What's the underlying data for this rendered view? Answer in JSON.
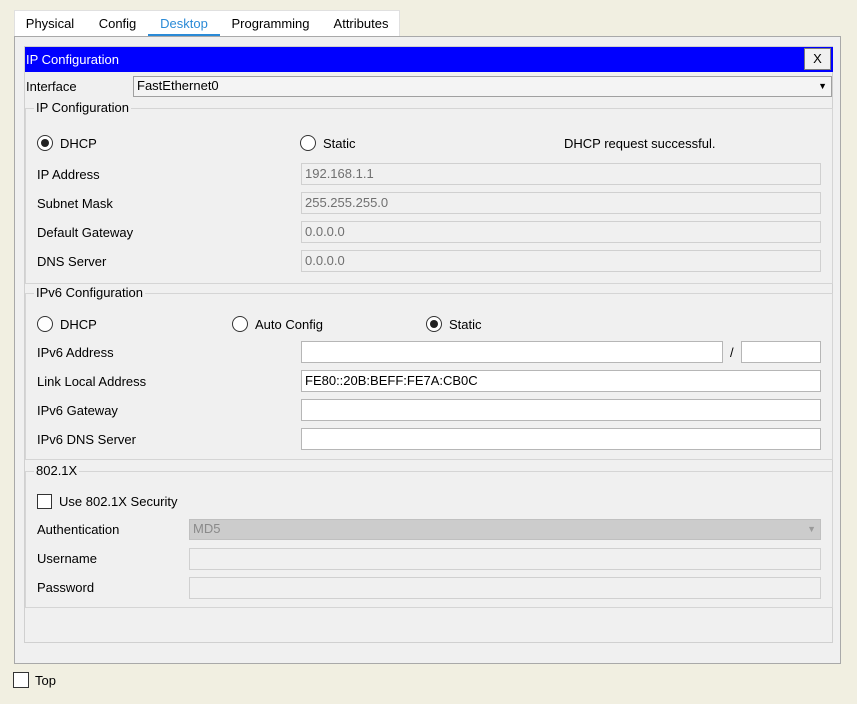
{
  "tabs": [
    "Physical",
    "Config",
    "Desktop",
    "Programming",
    "Attributes"
  ],
  "active_tab": "Desktop",
  "window": {
    "title": "IP Configuration",
    "close_label": "X"
  },
  "interface": {
    "label": "Interface",
    "value": "FastEthernet0"
  },
  "ipv4": {
    "group_title": "IP Configuration",
    "dhcp_label": "DHCP",
    "static_label": "Static",
    "mode": "DHCP",
    "status": "DHCP request successful.",
    "ip_address_label": "IP Address",
    "ip_address": "192.168.1.1",
    "subnet_mask_label": "Subnet Mask",
    "subnet_mask": "255.255.255.0",
    "default_gateway_label": "Default Gateway",
    "default_gateway": "0.0.0.0",
    "dns_server_label": "DNS Server",
    "dns_server": "0.0.0.0"
  },
  "ipv6": {
    "group_title": "IPv6 Configuration",
    "dhcp_label": "DHCP",
    "auto_config_label": "Auto Config",
    "static_label": "Static",
    "mode": "Static",
    "address_label": "IPv6 Address",
    "address": "",
    "prefix_separator": "/",
    "prefix_length": "",
    "link_local_label": "Link Local Address",
    "link_local": "FE80::20B:BEFF:FE7A:CB0C",
    "gateway_label": "IPv6 Gateway",
    "gateway": "",
    "dns_server_label": "IPv6 DNS Server",
    "dns_server": ""
  },
  "dot1x": {
    "group_title": "802.1X",
    "use_security_label": "Use 802.1X Security",
    "use_security": false,
    "authentication_label": "Authentication",
    "authentication": "MD5",
    "username_label": "Username",
    "username": "",
    "password_label": "Password",
    "password": ""
  },
  "footer": {
    "top_label": "Top",
    "top_checked": false
  },
  "colors": {
    "title_bar": "#0000ff",
    "active_tab": "#2a8ad6"
  },
  "icons": {
    "dropdown": "chevron-down-icon"
  }
}
